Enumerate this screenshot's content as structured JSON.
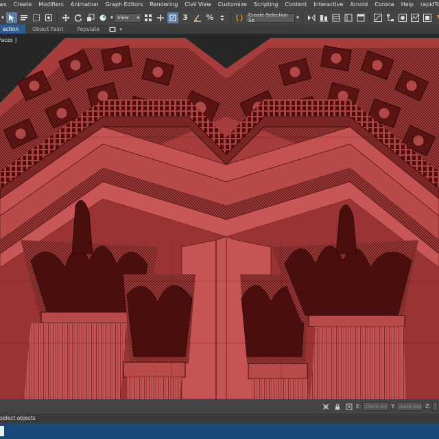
{
  "menu": {
    "items": [
      "ews",
      "Create",
      "Modifiers",
      "Animation",
      "Graph Editors",
      "Rendering",
      "Civil View",
      "Customize",
      "Scripting",
      "Content",
      "Interactive",
      "Arnold",
      "Corona",
      "Help",
      "rapidTools"
    ]
  },
  "toolbar": {
    "reference_coord": "View",
    "selection_set": "Create Selection Se",
    "angle_snap": "3",
    "percent_snap": "%"
  },
  "ribbon": {
    "tabs": [
      "ection",
      "Object Paint",
      "Populate"
    ]
  },
  "viewport": {
    "label": "Faces ]",
    "wire_color": "#3b0808",
    "surface_color": "#b54848"
  },
  "coords": {
    "x_label": "X:",
    "x_value": "37678,40m",
    "y_label": "Y:",
    "y_value": "-9465,889",
    "z_label": "Z:",
    "z_value": "Z:"
  },
  "status": {
    "prompt": "select objects"
  }
}
